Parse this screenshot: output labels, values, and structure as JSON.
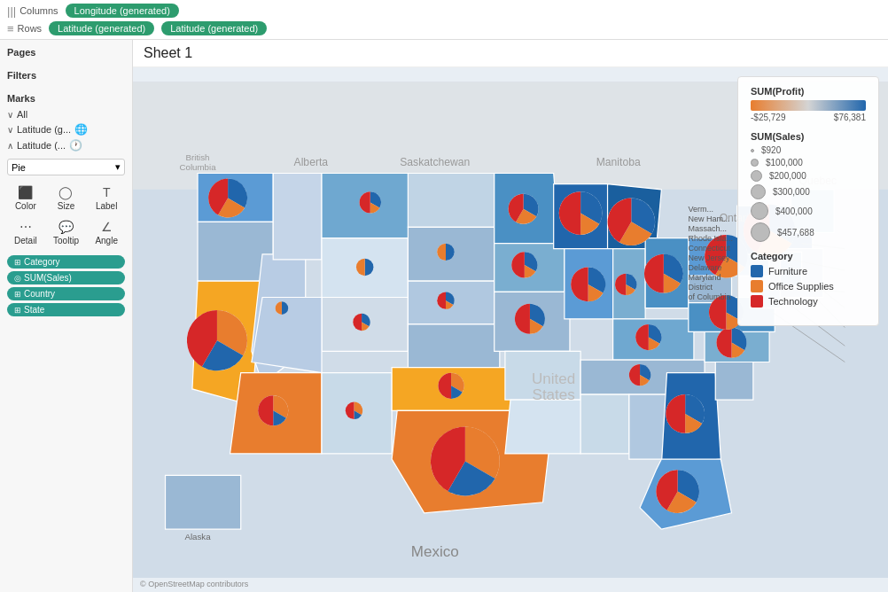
{
  "topbar": {
    "columns_label": "Columns",
    "columns_icon": "|||",
    "columns_pill": "Longitude (generated)",
    "rows_label": "Rows",
    "rows_icon": "≡",
    "rows_pill1": "Latitude (generated)",
    "rows_pill2": "Latitude (generated)"
  },
  "sidebar": {
    "pages_title": "Pages",
    "filters_title": "Filters",
    "marks_title": "Marks",
    "all_label": "All",
    "lat1_label": "Latitude (g...",
    "lat2_label": "Latitude (...",
    "pie_label": "Pie",
    "color_label": "Color",
    "size_label": "Size",
    "label_label": "Label",
    "detail_label": "Detail",
    "tooltip_label": "Tooltip",
    "angle_label": "Angle",
    "field1": "Category",
    "field2": "SUM(Sales)",
    "field3": "Country",
    "field4": "State"
  },
  "sheet": {
    "title": "Sheet 1"
  },
  "legend": {
    "profit_title": "SUM(Profit)",
    "profit_min": "-$25,729",
    "profit_max": "$76,381",
    "sales_title": "SUM(Sales)",
    "sales_values": [
      "$920",
      "$100,000",
      "$200,000",
      "$300,000",
      "$400,000",
      "$457,688"
    ],
    "category_title": "Category",
    "categories": [
      {
        "name": "Furniture",
        "color": "#2166ac"
      },
      {
        "name": "Office Supplies",
        "color": "#e87d2e"
      },
      {
        "name": "Technology",
        "color": "#d62728"
      }
    ]
  },
  "credit": "© OpenStreetMap contributors",
  "state_labels": [
    "Verm...",
    "New Ham...",
    "Massach...",
    "Rhode Isla...",
    "Connecticut",
    "New Jersey",
    "Delaware",
    "Maryland",
    "District",
    "of Columbia"
  ]
}
